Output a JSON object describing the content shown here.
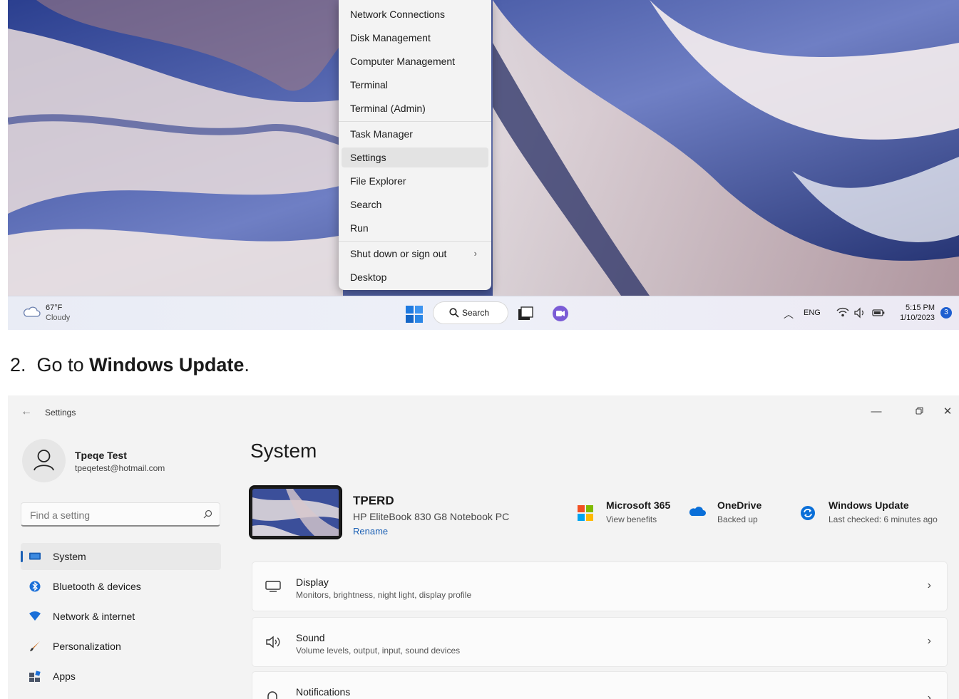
{
  "context_menu": {
    "items": [
      {
        "label": "Network Connections"
      },
      {
        "label": "Disk Management"
      },
      {
        "label": "Computer Management"
      },
      {
        "label": "Terminal"
      },
      {
        "label": "Terminal (Admin)"
      },
      {
        "label": "Task Manager"
      },
      {
        "label": "Settings",
        "selected": true
      },
      {
        "label": "File Explorer"
      },
      {
        "label": "Search"
      },
      {
        "label": "Run"
      },
      {
        "label": "Shut down or sign out",
        "has_submenu": true
      },
      {
        "label": "Desktop"
      }
    ]
  },
  "taskbar": {
    "weather_temp": "67°F",
    "weather_desc": "Cloudy",
    "search_label": "Search",
    "language": "ENG",
    "time": "5:15 PM",
    "date": "1/10/2023",
    "notification_count": "3"
  },
  "instructions": {
    "step_number": "2.",
    "step_prefix": "Go to",
    "step_target": "Windows Update",
    "step_suffix": "."
  },
  "settings_window": {
    "title": "Settings",
    "user": {
      "name": "Tpeqe Test",
      "email": "tpeqetest@hotmail.com"
    },
    "search_placeholder": "Find a setting",
    "nav": [
      {
        "label": "System",
        "icon": "system-icon",
        "active": true
      },
      {
        "label": "Bluetooth & devices",
        "icon": "bluetooth-icon"
      },
      {
        "label": "Network & internet",
        "icon": "wifi-icon"
      },
      {
        "label": "Personalization",
        "icon": "brush-icon"
      },
      {
        "label": "Apps",
        "icon": "apps-icon"
      }
    ],
    "page_title": "System",
    "device": {
      "name": "TPERD",
      "model": "HP EliteBook 830 G8 Notebook PC",
      "rename_label": "Rename"
    },
    "quick_links": [
      {
        "title": "Microsoft 365",
        "subtitle": "View benefits",
        "icon": "microsoft-365-icon"
      },
      {
        "title": "OneDrive",
        "subtitle": "Backed up",
        "icon": "onedrive-icon"
      },
      {
        "title": "Windows Update",
        "subtitle": "Last checked: 6 minutes ago",
        "icon": "windows-update-icon"
      }
    ],
    "cards": [
      {
        "title": "Display",
        "subtitle": "Monitors, brightness, night light, display profile",
        "icon": "display-icon"
      },
      {
        "title": "Sound",
        "subtitle": "Volume levels, output, input, sound devices",
        "icon": "sound-icon"
      },
      {
        "title": "Notifications",
        "subtitle": "",
        "icon": "notifications-icon"
      }
    ]
  },
  "colors": {
    "accent": "#1a5fb4",
    "windows_blue": "#0a6fd8"
  }
}
